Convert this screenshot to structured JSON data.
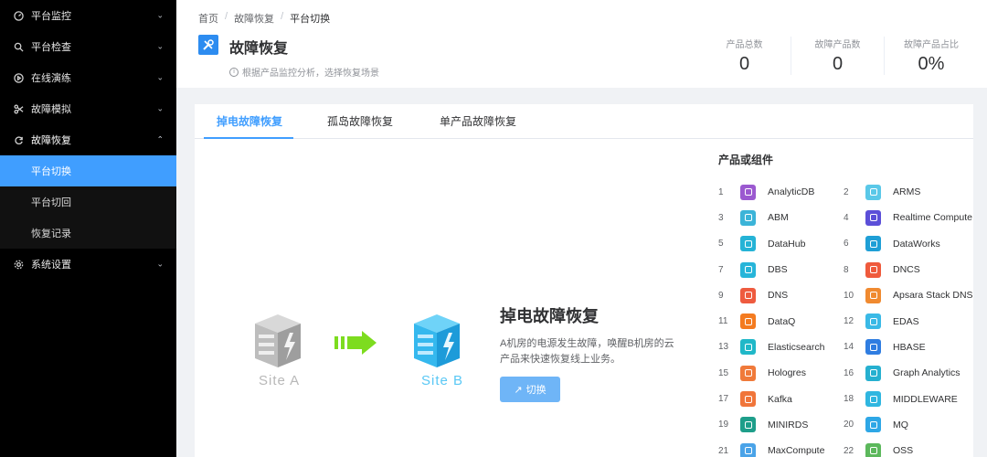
{
  "sidebar": {
    "items": [
      {
        "label": "平台监控",
        "icon": "gauge-icon"
      },
      {
        "label": "平台检查",
        "icon": "search-icon"
      },
      {
        "label": "在线演练",
        "icon": "play-circle-icon"
      },
      {
        "label": "故障模拟",
        "icon": "scissors-icon"
      },
      {
        "label": "故障恢复",
        "icon": "refresh-icon"
      }
    ],
    "sub_items": [
      {
        "label": "平台切换"
      },
      {
        "label": "平台切回"
      },
      {
        "label": "恢复记录"
      }
    ],
    "settings": {
      "label": "系统设置",
      "icon": "gear-icon"
    }
  },
  "breadcrumb": {
    "home": "首页",
    "section": "故障恢复",
    "current": "平台切换"
  },
  "header": {
    "title": "故障恢复",
    "description": "根据产品监控分析，选择恢复场景"
  },
  "stats": [
    {
      "label": "产品总数",
      "value": "0"
    },
    {
      "label": "故障产品数",
      "value": "0"
    },
    {
      "label": "故障产品占比",
      "value": "0%"
    }
  ],
  "tabs": [
    {
      "label": "掉电故障恢复"
    },
    {
      "label": "孤岛故障恢复"
    },
    {
      "label": "单产品故障恢复"
    }
  ],
  "illustration": {
    "site_a": "Site A",
    "site_b": "Site B"
  },
  "scenario": {
    "title": "掉电故障恢复",
    "description": "A机房的电源发生故障，唤醒B机房的云产品来快速恢复线上业务。",
    "button": "切换"
  },
  "products": {
    "title": "产品或组件",
    "items": [
      {
        "num": "1",
        "name": "AnalyticDB",
        "color": "#9b59d0"
      },
      {
        "num": "2",
        "name": "ARMS",
        "color": "#5ac8e8"
      },
      {
        "num": "3",
        "name": "ABM",
        "color": "#3bb4d8"
      },
      {
        "num": "4",
        "name": "Realtime Compute",
        "color": "#5b4fd8"
      },
      {
        "num": "5",
        "name": "DataHub",
        "color": "#25b3d6"
      },
      {
        "num": "6",
        "name": "DataWorks",
        "color": "#1f9fd6"
      },
      {
        "num": "7",
        "name": "DBS",
        "color": "#27b5d9"
      },
      {
        "num": "8",
        "name": "DNCS",
        "color": "#ef5a3c"
      },
      {
        "num": "9",
        "name": "DNS",
        "color": "#ee5b3f"
      },
      {
        "num": "10",
        "name": "Apsara Stack DNS",
        "color": "#f08a30"
      },
      {
        "num": "11",
        "name": "DataQ",
        "color": "#f47b20"
      },
      {
        "num": "12",
        "name": "EDAS",
        "color": "#3ab9e6"
      },
      {
        "num": "13",
        "name": "Elasticsearch",
        "color": "#20b8c8"
      },
      {
        "num": "14",
        "name": "HBASE",
        "color": "#2f7de1"
      },
      {
        "num": "15",
        "name": "Hologres",
        "color": "#f07a3a"
      },
      {
        "num": "16",
        "name": "Graph Analytics",
        "color": "#26b0d0"
      },
      {
        "num": "17",
        "name": "Kafka",
        "color": "#f0753a"
      },
      {
        "num": "18",
        "name": "MIDDLEWARE",
        "color": "#2fb6e0"
      },
      {
        "num": "19",
        "name": "MINIRDS",
        "color": "#1e9e8a"
      },
      {
        "num": "20",
        "name": "MQ",
        "color": "#2ea7e6"
      },
      {
        "num": "21",
        "name": "MaxCompute",
        "color": "#4aa3e8"
      },
      {
        "num": "22",
        "name": "OSS",
        "color": "#5cb85c"
      }
    ]
  }
}
